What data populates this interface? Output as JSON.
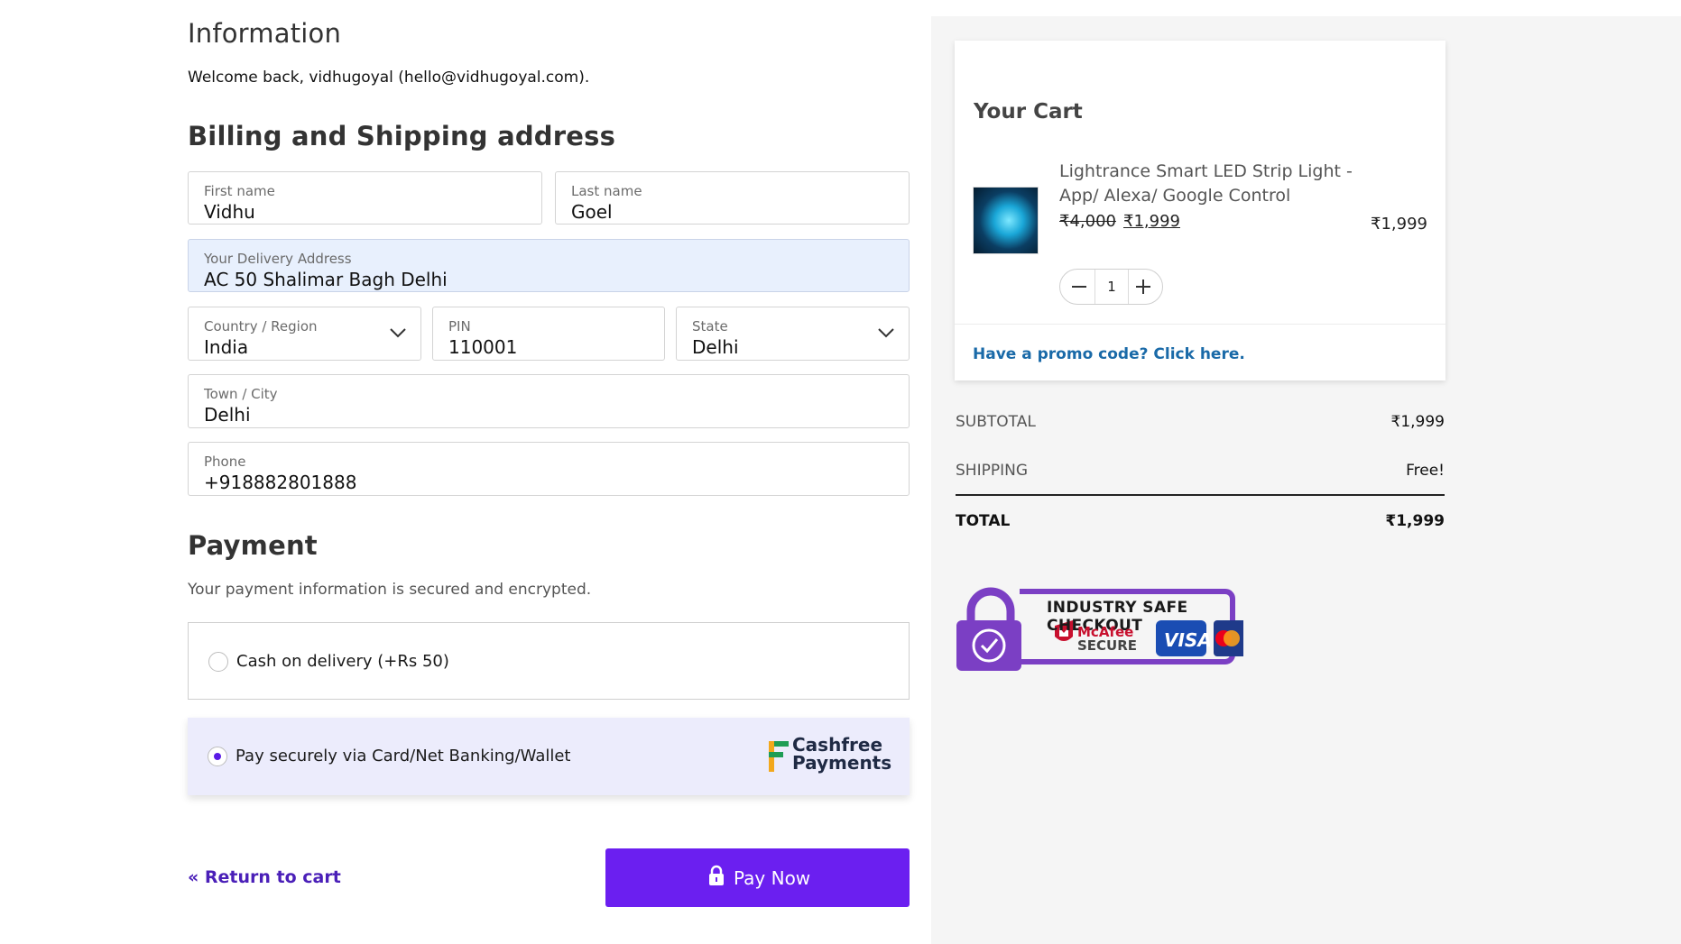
{
  "information": {
    "heading": "Information",
    "welcome": "Welcome back, vidhugoyal (hello@vidhugoyal.com)."
  },
  "billing": {
    "heading": "Billing and Shipping address",
    "first_name": {
      "label": "First name",
      "value": "Vidhu"
    },
    "last_name": {
      "label": "Last name",
      "value": "Goel"
    },
    "address": {
      "label": "Your Delivery Address",
      "value": "AC 50 Shalimar Bagh Delhi"
    },
    "country": {
      "label": "Country / Region",
      "value": "India"
    },
    "pin": {
      "label": "PIN",
      "value": "110001"
    },
    "state": {
      "label": "State",
      "value": "Delhi"
    },
    "city": {
      "label": "Town / City",
      "value": "Delhi"
    },
    "phone": {
      "label": "Phone",
      "value": "+918882801888"
    }
  },
  "payment": {
    "heading": "Payment",
    "secure_note": "Your payment information is secured and encrypted.",
    "options": [
      {
        "label": "Cash on delivery (+Rs 50)",
        "selected": false
      },
      {
        "label": "Pay securely via Card/Net Banking/Wallet",
        "selected": true
      }
    ],
    "provider_logo": {
      "line1": "Cashfree",
      "line2": "Payments"
    }
  },
  "actions": {
    "return_label": "« Return to cart",
    "pay_label": "Pay Now"
  },
  "cart": {
    "heading": "Your Cart",
    "item": {
      "name": "Lightrance Smart LED Strip Light - App/ Alexa/ Google Control",
      "old_price": "₹4,000",
      "new_price": "₹1,999",
      "line_total": "₹1,999",
      "quantity": "1"
    },
    "promo": "Have a promo code? Click here."
  },
  "summary": {
    "subtotal_label": "SUBTOTAL",
    "subtotal_value": "₹1,999",
    "shipping_label": "SHIPPING",
    "shipping_value": "Free!",
    "total_label": "TOTAL",
    "total_value": "₹1,999"
  },
  "trust_badge": {
    "headline": "INDUSTRY SAFE CHECKOUT",
    "mcafee_line1": "McAfee",
    "mcafee_line2": "SECURE",
    "visa": "VISA"
  },
  "colors": {
    "accent": "#6b1ff0",
    "link": "#1a6aa8",
    "badge_purple": "#7b3fc4"
  }
}
